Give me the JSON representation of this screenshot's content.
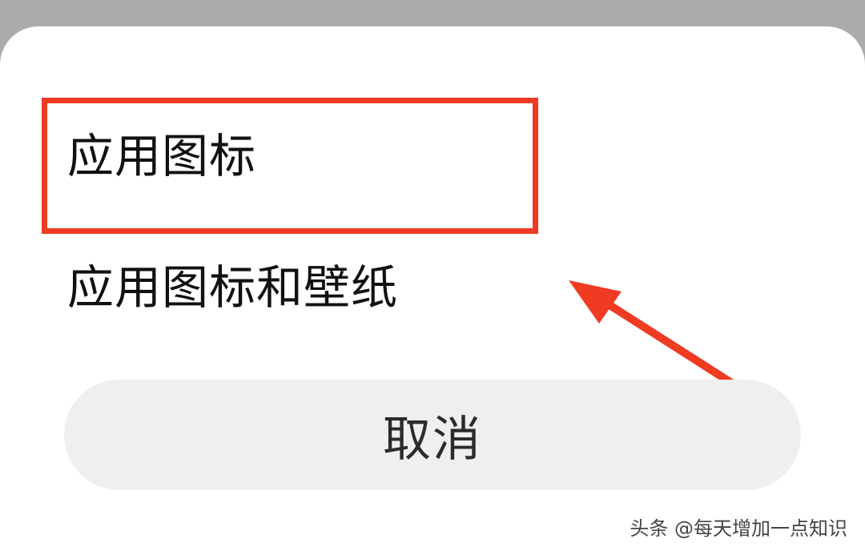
{
  "dialog": {
    "options": [
      {
        "label": "应用图标"
      },
      {
        "label": "应用图标和壁纸"
      }
    ],
    "cancel_label": "取消"
  },
  "annotations": {
    "highlight_color": "#ee3b22",
    "arrow_color": "#ee3b22",
    "arrow_icon": "arrow-pointer-icon"
  },
  "watermark": {
    "text": "头条 @每天增加一点知识"
  },
  "colors": {
    "backdrop": "#ababab",
    "sheet": "#ffffff",
    "cancel_bg": "#efefef",
    "text": "#111111"
  }
}
